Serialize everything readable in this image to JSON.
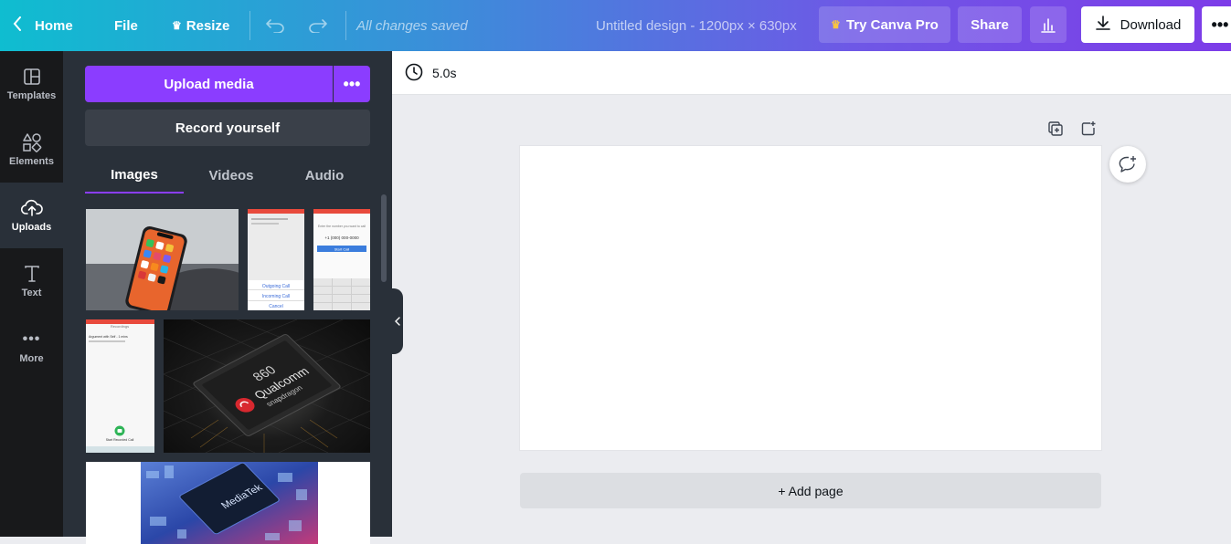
{
  "topbar": {
    "home_label": "Home",
    "file_label": "File",
    "resize_label": "Resize",
    "saved_status": "All changes saved",
    "design_title": "Untitled design - 1200px × 630px",
    "pro_label": "Try Canva Pro",
    "share_label": "Share",
    "download_label": "Download"
  },
  "sidebar": {
    "items": [
      {
        "label": "Templates",
        "icon": "templates-icon"
      },
      {
        "label": "Elements",
        "icon": "elements-icon"
      },
      {
        "label": "Uploads",
        "icon": "upload-cloud-icon",
        "active": true
      },
      {
        "label": "Text",
        "icon": "text-icon"
      },
      {
        "label": "More",
        "icon": "more-dots-icon"
      }
    ]
  },
  "panel": {
    "upload_label": "Upload media",
    "record_label": "Record yourself",
    "tabs": [
      {
        "label": "Images",
        "active": true
      },
      {
        "label": "Videos"
      },
      {
        "label": "Audio"
      }
    ]
  },
  "thumb_texts": {
    "outgoing": "Outgoing Call",
    "incoming": "Incoming Call",
    "cancel": "Cancel",
    "enter_number": "Enter the number you want to call",
    "number": "+1 (000) 000-0000",
    "start_call": "Start Call",
    "recordings": "Recordings",
    "argument": "Argument with Self - 1 mins",
    "start_recorded": "Start Recorded Call",
    "chip_num": "860",
    "chip_brand": "Qualcomm",
    "chip_sub": "snapdragon",
    "mediatek": "MediaTek"
  },
  "editor": {
    "duration": "5.0s",
    "add_page_label": "+ Add page"
  },
  "colors": {
    "brand_purple": "#8b3dff",
    "panel_bg": "#293039",
    "nav_bg": "#18191b"
  }
}
